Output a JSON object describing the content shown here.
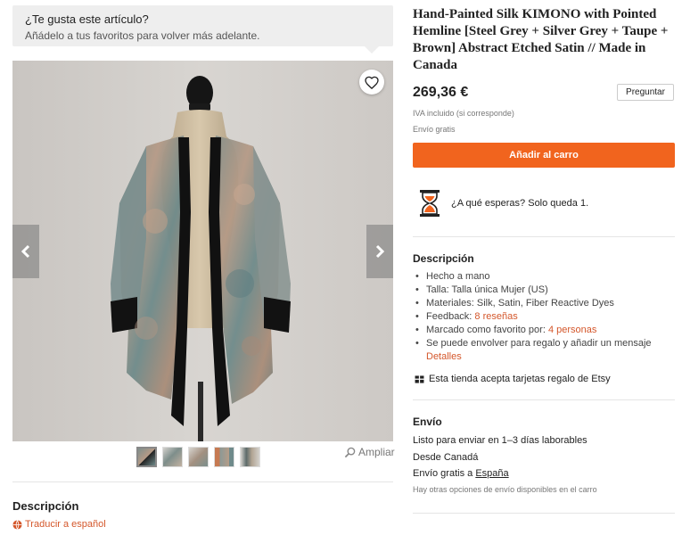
{
  "favorite_prompt": {
    "title": "¿Te gusta este artículo?",
    "subtitle": "Añádelo a tus favoritos para volver más adelante."
  },
  "gallery": {
    "zoom_label": "Ampliar",
    "thumbnail_count": 5
  },
  "left_description": {
    "title": "Descripción",
    "translate_label": "Traducir a español"
  },
  "product": {
    "title": "Hand-Painted Silk KIMONO with Pointed Hemline [Steel Grey + Silver Grey + Taupe + Brown] Abstract Etched Satin // Made in Canada",
    "price": "269,36 €",
    "ask_label": "Preguntar",
    "vat_note": "IVA incluido (si corresponde)",
    "free_shipping": "Envío gratis",
    "add_to_cart": "Añadir al carro"
  },
  "urgency": {
    "lead": "¿A qué esperas?",
    "text": " Solo queda 1."
  },
  "description": {
    "title": "Descripción",
    "handmade": "Hecho a mano",
    "size": "Talla: Talla única Mujer (US)",
    "materials": "Materiales: Silk, Satin, Fiber Reactive Dyes",
    "feedback_label": "Feedback: ",
    "feedback_link": "8 reseñas",
    "favorited_label": "Marcado como favorito por: ",
    "favorited_link": "4 personas",
    "gift_wrap": "Se puede envolver para regalo y añadir un mensaje",
    "details_link": "Detalles",
    "gift_card": "Esta tienda acepta tarjetas regalo de Etsy"
  },
  "shipping": {
    "title": "Envío",
    "ready": "Listo para enviar en 1–3 días laborables",
    "from": "Desde Canadá",
    "free_to_label": "Envío gratis a ",
    "free_to_country": "España",
    "other_options": "Hay otras opciones de envío disponibles en el carro"
  },
  "colors": {
    "accent": "#f1641e",
    "link": "#d4572b"
  }
}
